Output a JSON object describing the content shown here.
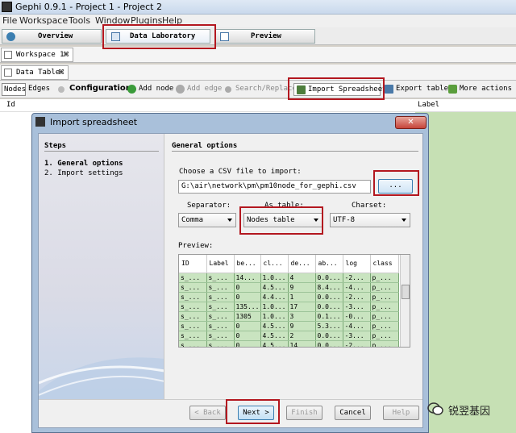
{
  "app": {
    "title": "Gephi 0.9.1 - Project 1 - Project 2"
  },
  "menu": [
    "File",
    "Workspace",
    "Tools",
    "Window",
    "Plugins",
    "Help"
  ],
  "modes": {
    "overview": "Overview",
    "data_laboratory": "Data Laboratory",
    "preview": "Preview"
  },
  "workspace_tab": {
    "label": "Workspace 1",
    "close": "⌘"
  },
  "datatable_tab": {
    "label": "Data Table",
    "close": "⌘"
  },
  "toolbar": {
    "nodes": "Nodes",
    "edges": "Edges",
    "configuration": "Configuration",
    "add_node": "Add node",
    "add_edge": "Add edge",
    "search_replace": "Search/Replace",
    "import_spreadsheet": "Import Spreadsheet",
    "export_table": "Export table",
    "more_actions": "More actions"
  },
  "table_header": {
    "id": "Id",
    "label": "Label"
  },
  "dialog": {
    "title": "Import spreadsheet",
    "close": "✕",
    "steps_title": "Steps",
    "steps": [
      "1.  General options",
      "2.  Import settings"
    ],
    "general_title": "General options",
    "choose_label": "Choose a CSV file to import:",
    "file_path": "G:\\air\\network\\pm\\pm10node_for_gephi.csv",
    "browse": "...",
    "separator_label": "Separator:",
    "as_table_label": "As table:",
    "charset_label": "Charset:",
    "separator_value": "Comma",
    "as_table_value": "Nodes table",
    "charset_value": "UTF-8",
    "preview_label": "Preview:",
    "preview_headers": [
      "ID",
      "Label",
      "be...",
      "cl...",
      "de...",
      "ab...",
      "log",
      "class"
    ],
    "preview_rows": [
      [
        "s_...",
        "s_...",
        "14...",
        "1.0...",
        "4",
        "0.0...",
        "-2...",
        "p_..."
      ],
      [
        "s_...",
        "s_...",
        "0",
        "4.5...",
        "9",
        "8.4...",
        "-4...",
        "p_..."
      ],
      [
        "s_...",
        "s_...",
        "0",
        "4.4...",
        "1",
        "0.0...",
        "-2...",
        "p_..."
      ],
      [
        "s_...",
        "s_...",
        "135...",
        "1.0...",
        "17",
        "0.0...",
        "-3...",
        "p_..."
      ],
      [
        "s_...",
        "s_...",
        "1305",
        "1.0...",
        "3",
        "0.1...",
        "-0...",
        "p_..."
      ],
      [
        "s_...",
        "s_...",
        "0",
        "4.5...",
        "9",
        "5.3...",
        "-4...",
        "p_..."
      ],
      [
        "s_...",
        "s_...",
        "0",
        "4.5...",
        "2",
        "0.0...",
        "-3...",
        "p_..."
      ],
      [
        "s_...",
        "s_...",
        "0",
        "4.5...",
        "14",
        "0.0...",
        "-2...",
        "p_..."
      ]
    ],
    "buttons": {
      "back": "< Back",
      "next": "Next >",
      "finish": "Finish",
      "cancel": "Cancel",
      "help": "Help"
    }
  },
  "watermark": {
    "text": "锐翌基因"
  },
  "colors": {
    "highlight_red": "#b3171f",
    "table_green": "#c6e0b4",
    "preview_green": "#c9e4c0"
  }
}
